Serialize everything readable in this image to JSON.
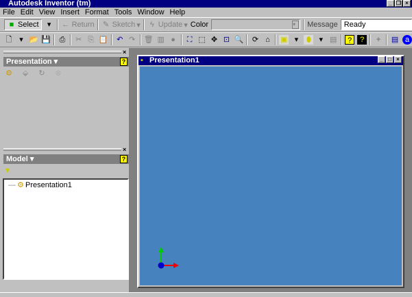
{
  "app": {
    "title": "Autodesk Inventor (tm)"
  },
  "menu": [
    "File",
    "Edit",
    "View",
    "Insert",
    "Format",
    "Tools",
    "Window",
    "Help"
  ],
  "toolbar1": {
    "select": "Select",
    "return": "Return",
    "sketch": "Sketch",
    "update": "Update",
    "color_label": "Color",
    "color_value": "",
    "message_label": "Message",
    "message_value": "Ready"
  },
  "presentation_panel": {
    "title": "Presentation ▾"
  },
  "model_panel": {
    "title": "Model ▾",
    "tree": [
      "Presentation1"
    ]
  },
  "document": {
    "title": "Presentation1"
  },
  "colors": {
    "viewport": "#4682be",
    "titlebar": "#000080"
  }
}
